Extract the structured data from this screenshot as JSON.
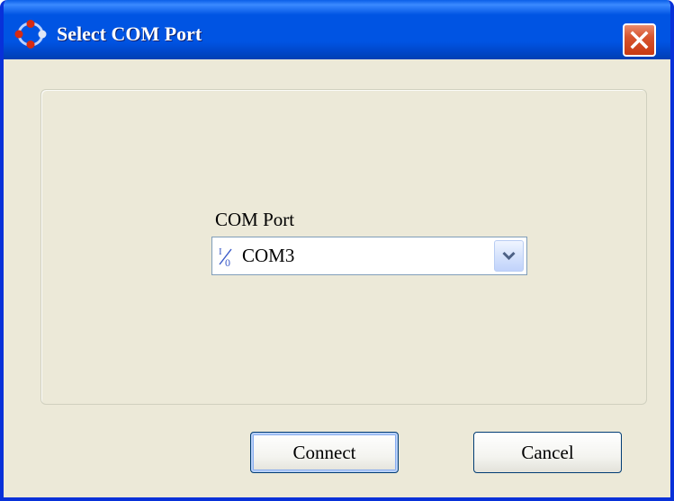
{
  "window": {
    "title": "Select COM Port",
    "icons": {
      "app": "com-port-diamond-icon",
      "close": "close-icon"
    }
  },
  "form": {
    "port_label": "COM Port",
    "selected_port": "COM3",
    "port_icon": "io-port-icon",
    "dropdown_icon": "chevron-down-icon"
  },
  "buttons": {
    "connect": "Connect",
    "cancel": "Cancel"
  },
  "colors": {
    "titlebar": "#0054e3",
    "window_bg": "#ece9d8",
    "close_button": "#d7542e"
  }
}
